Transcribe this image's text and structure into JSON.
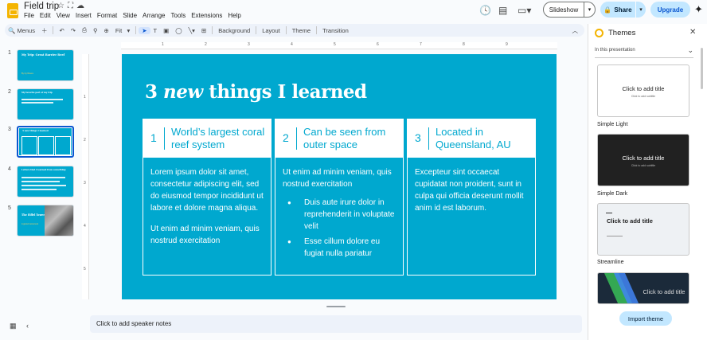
{
  "header": {
    "doc_title": "Field trip",
    "title_icons": [
      "star-icon",
      "folder-move-icon",
      "cloud-status-icon"
    ],
    "menu": [
      "File",
      "Edit",
      "View",
      "Insert",
      "Format",
      "Slide",
      "Arrange",
      "Tools",
      "Extensions",
      "Help"
    ],
    "slideshow_label": "Slideshow",
    "share_label": "Share",
    "upgrade_label": "Upgrade",
    "colors": {
      "accent": "#c2e7ff",
      "brand_yellow": "#f4b400"
    }
  },
  "toolbar": {
    "menus_label": "Menus",
    "zoom_label": "Fit",
    "background_label": "Background",
    "layout_label": "Layout",
    "theme_label": "Theme",
    "transition_label": "Transition"
  },
  "filmstrip": {
    "selected": 3,
    "slides": [
      {
        "num": "1",
        "title": "My Trip: Great Barrier Reef",
        "subtitle": "By Ivy Rivera"
      },
      {
        "num": "2",
        "title": "My favorite part of my trip"
      },
      {
        "num": "3",
        "title": "3 new things I learned"
      },
      {
        "num": "4",
        "title": "Letters that I learned from something"
      },
      {
        "num": "5",
        "title": "The Eiffel Tower",
        "subtitle": "A grand monument"
      }
    ]
  },
  "rulers": {
    "h_ticks": [
      "1",
      "2",
      "3",
      "4",
      "5",
      "6",
      "7",
      "8",
      "9"
    ],
    "v_ticks": [
      "1",
      "2",
      "3",
      "4",
      "5"
    ]
  },
  "slide": {
    "title_num": "3",
    "title_italic": "new",
    "title_rest": "things I learned",
    "bg_color": "#00a8cf",
    "columns": [
      {
        "num": "1",
        "title": "World’s largest coral reef system",
        "paragraphs": [
          "Lorem ipsum dolor sit amet, consectetur adipiscing elit, sed do eiusmod tempor incididunt ut labore et dolore magna aliqua.",
          "Ut enim ad minim veniam, quis nostrud exercitation"
        ]
      },
      {
        "num": "2",
        "title": "Can be seen from outer space",
        "paragraphs": [
          "Ut enim ad minim veniam, quis nostrud exercitation"
        ],
        "bullets": [
          "Duis aute irure dolor in reprehenderit in voluptate velit",
          "Esse cillum dolore eu fugiat nulla pariatur"
        ]
      },
      {
        "num": "3",
        "title": "Located in Queensland, AU",
        "paragraphs": [
          "Excepteur sint occaecat cupidatat non proident, sunt in culpa qui officia deserunt mollit anim id est laborum."
        ]
      }
    ]
  },
  "notes": {
    "placeholder": "Click to add speaker notes"
  },
  "themes": {
    "title": "Themes",
    "section": "In this presentation",
    "cards": [
      {
        "name": "Simple Light",
        "cta": "Click to add title",
        "sub": "Click to add subtitle"
      },
      {
        "name": "Simple Dark",
        "cta": "Click to add title",
        "sub": "Click to add subtitle"
      },
      {
        "name": "Streamline",
        "cta": "Click to add title"
      },
      {
        "cta": "Click to add title"
      }
    ],
    "import_label": "Import theme"
  }
}
